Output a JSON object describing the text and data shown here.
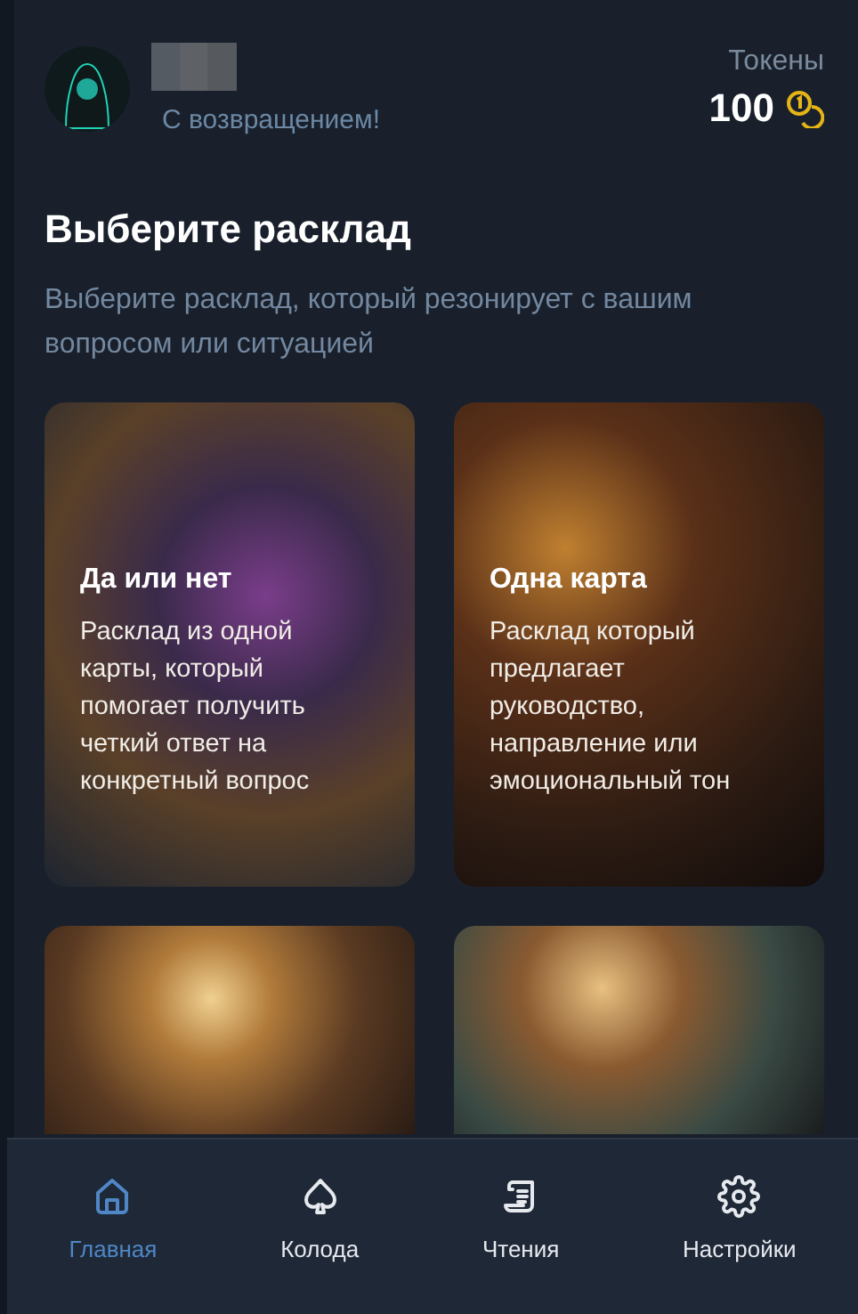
{
  "header": {
    "greeting": "С возвращением!",
    "tokens_label": "Токены",
    "tokens_value": "100"
  },
  "title": "Выберите расклад",
  "subtitle": "Выберите расклад, который резонирует с вашим вопросом или ситуацией",
  "spreads": [
    {
      "kind": "full",
      "title": "Да или нет",
      "description": "Расклад из одной карты, который помогает получить четкий ответ на конкретный вопрос"
    },
    {
      "kind": "full",
      "title": "Одна карта",
      "description": "Расклад который предлагает руководство, направление или эмоциональный тон"
    },
    {
      "kind": "cut"
    },
    {
      "kind": "cut"
    }
  ],
  "nav": [
    {
      "label": "Главная",
      "kind": "home",
      "selected": true
    },
    {
      "label": "Колода",
      "kind": "spade",
      "selected": false
    },
    {
      "label": "Чтения",
      "kind": "scroll",
      "selected": false
    },
    {
      "label": "Настройки",
      "kind": "gear",
      "selected": false
    }
  ]
}
